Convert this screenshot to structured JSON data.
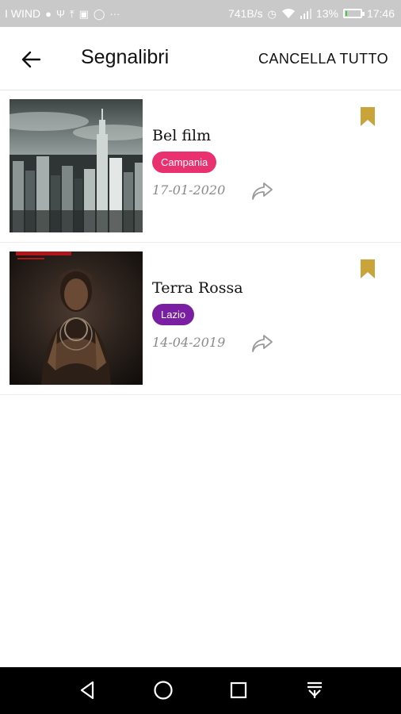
{
  "status_bar": {
    "carrier": "I WIND",
    "network_speed": "741B/s",
    "battery_percent": "13%",
    "battery_level": 0.13,
    "time": "17:46"
  },
  "app_bar": {
    "title": "Segnalibri",
    "clear_all_label": "CANCELLA TUTTO"
  },
  "bookmarks": [
    {
      "title": "Bel film",
      "region": "Campania",
      "region_color": "#e8316e",
      "date": "17-01-2020",
      "thumbnail": "city-skyline-bw"
    },
    {
      "title": "Terra Rossa",
      "region": "Lazio",
      "region_color": "#7b1fa2",
      "date": "14-04-2019",
      "thumbnail": "portrait-dark-poster"
    }
  ],
  "colors": {
    "bookmark_gold": "#c9a43a",
    "date_gray": "#8a8a8a"
  },
  "icons": {
    "back": "arrow-left-icon",
    "bookmark": "bookmark-filled-icon",
    "share": "share-arrow-icon",
    "nav_back": "triangle-back-icon",
    "nav_home": "circle-home-icon",
    "nav_recents": "square-recents-icon",
    "nav_notifications": "pull-down-icon"
  }
}
